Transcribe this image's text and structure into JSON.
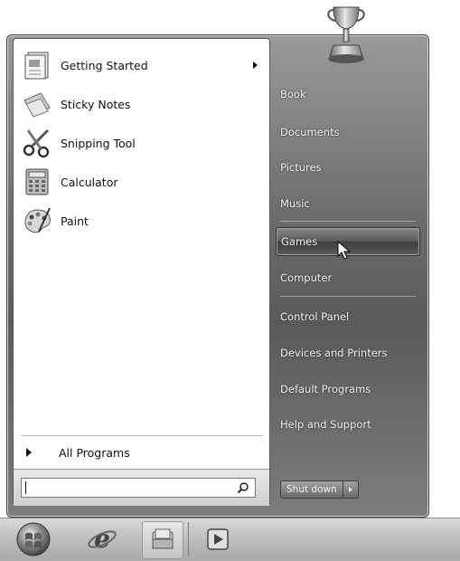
{
  "left_pane": {
    "programs": [
      {
        "label": "Getting Started",
        "icon": "getting-started-icon",
        "has_submenu": true
      },
      {
        "label": "Sticky Notes",
        "icon": "sticky-notes-icon",
        "has_submenu": false
      },
      {
        "label": "Snipping Tool",
        "icon": "scissors-icon",
        "has_submenu": false
      },
      {
        "label": "Calculator",
        "icon": "calculator-icon",
        "has_submenu": false
      },
      {
        "label": "Paint",
        "icon": "paint-palette-icon",
        "has_submenu": false
      }
    ],
    "all_programs_label": "All Programs",
    "search": {
      "value": "",
      "placeholder": ""
    }
  },
  "right_pane": {
    "user_picture": "trophy-icon",
    "items": [
      {
        "label": "Book"
      },
      {
        "label": "Documents"
      },
      {
        "label": "Pictures"
      },
      {
        "label": "Music"
      },
      {
        "label": "Games",
        "highlighted": true
      },
      {
        "label": "Computer"
      },
      {
        "label": "Control Panel"
      },
      {
        "label": "Devices and Printers"
      },
      {
        "label": "Default Programs"
      },
      {
        "label": "Help and Support"
      }
    ],
    "shutdown_label": "Shut down"
  },
  "taskbar": {
    "items": [
      "start-orb-icon",
      "internet-explorer-icon",
      "windows-explorer-icon",
      "media-player-icon"
    ]
  },
  "colors": {
    "menu_frame": "#6c6c6c",
    "left_pane_bg": "#ffffff",
    "right_text": "#f2f2f2",
    "taskbar": "#bdbdbd"
  }
}
